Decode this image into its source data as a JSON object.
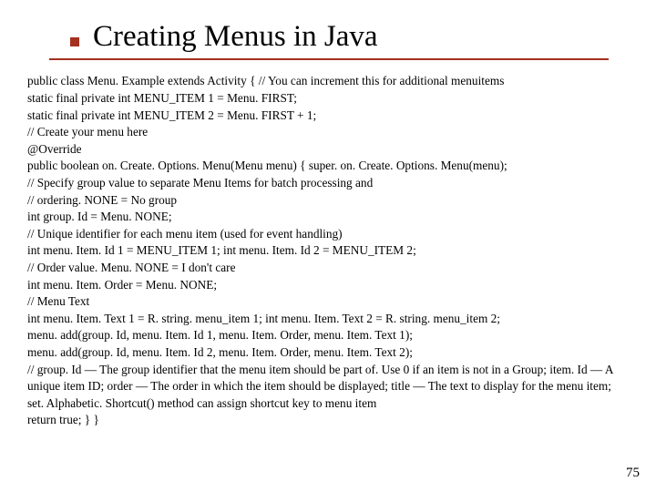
{
  "title": "Creating Menus in Java",
  "lines": [
    "public class Menu. Example extends Activity {  // You can increment this for additional menuitems",
    "static final private int MENU_ITEM 1 = Menu. FIRST;",
    "static final private int MENU_ITEM 2 = Menu. FIRST + 1;",
    "// Create your menu here",
    "@Override",
    "public boolean on. Create. Options. Menu(Menu menu) { super. on. Create. Options. Menu(menu);",
    "// Specify group value to separate Menu Items for batch processing and",
    "// ordering. NONE = No group",
    "int group. Id = Menu. NONE;",
    "// Unique identifier for each menu item (used for event handling)",
    "int menu. Item. Id 1 = MENU_ITEM 1; int menu. Item. Id 2 = MENU_ITEM 2;",
    "// Order value. Menu. NONE = I don't care",
    "int menu. Item. Order = Menu. NONE;",
    "// Menu Text",
    "int menu. Item. Text 1 = R. string. menu_item 1; int menu. Item. Text 2 = R. string. menu_item 2;",
    "menu. add(group. Id, menu. Item. Id 1, menu. Item. Order, menu. Item. Text 1);",
    "menu. add(group. Id, menu. Item. Id 2, menu. Item. Order, menu. Item. Text 2);",
    "// group. Id — The group identifier that the menu item should be part of. Use 0 if an item is not in a Group; item. Id — A unique item ID; order — The order in which the item should be displayed; title — The text to display for the menu item; set. Alphabetic. Shortcut() method can assign shortcut key to menu item",
    " return true;  }  }"
  ],
  "page_number": "75"
}
